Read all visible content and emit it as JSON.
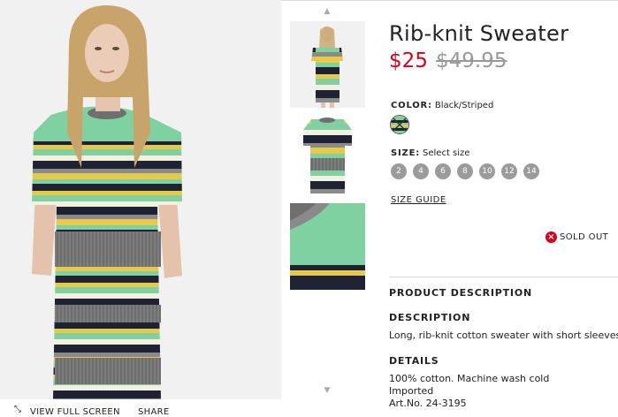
{
  "gallery": {
    "view_full_screen_label": "VIEW FULL SCREEN",
    "share_label": "SHARE",
    "scroll_up_glyph": "▲",
    "scroll_down_glyph": "▼"
  },
  "product": {
    "title": "Rib-knit Sweater",
    "price": "$25",
    "old_price": "$49.95",
    "color_label": "COLOR:",
    "color_value": "Black/Striped",
    "size_label": "SIZE:",
    "size_value": "Select size",
    "sizes": [
      "2",
      "4",
      "6",
      "8",
      "10",
      "12",
      "14"
    ],
    "size_guide_label": "SIZE GUIDE",
    "sold_out_label": "SOLD OUT"
  },
  "details_section": {
    "product_description_title": "PRODUCT DESCRIPTION",
    "description_title": "DESCRIPTION",
    "description_text": "Long, rib-knit cotton sweater with short sleeves.",
    "details_title": "DETAILS",
    "details_lines": [
      "100% cotton. Machine wash cold",
      "Imported",
      "Art.No. 24-3195"
    ]
  },
  "colors": {
    "price_red": "#d6001c",
    "stripe_mint": "#7fd1a2",
    "stripe_yellow": "#e6c84a",
    "stripe_navy": "#1f2233",
    "stripe_grey": "#8a8a8a",
    "size_button": "#9b9b9b"
  },
  "icons": {
    "full_screen": "expand-icon",
    "sold_out": "close-circle-icon",
    "thumb_up": "chevron-up-icon",
    "thumb_down": "chevron-down-icon"
  }
}
